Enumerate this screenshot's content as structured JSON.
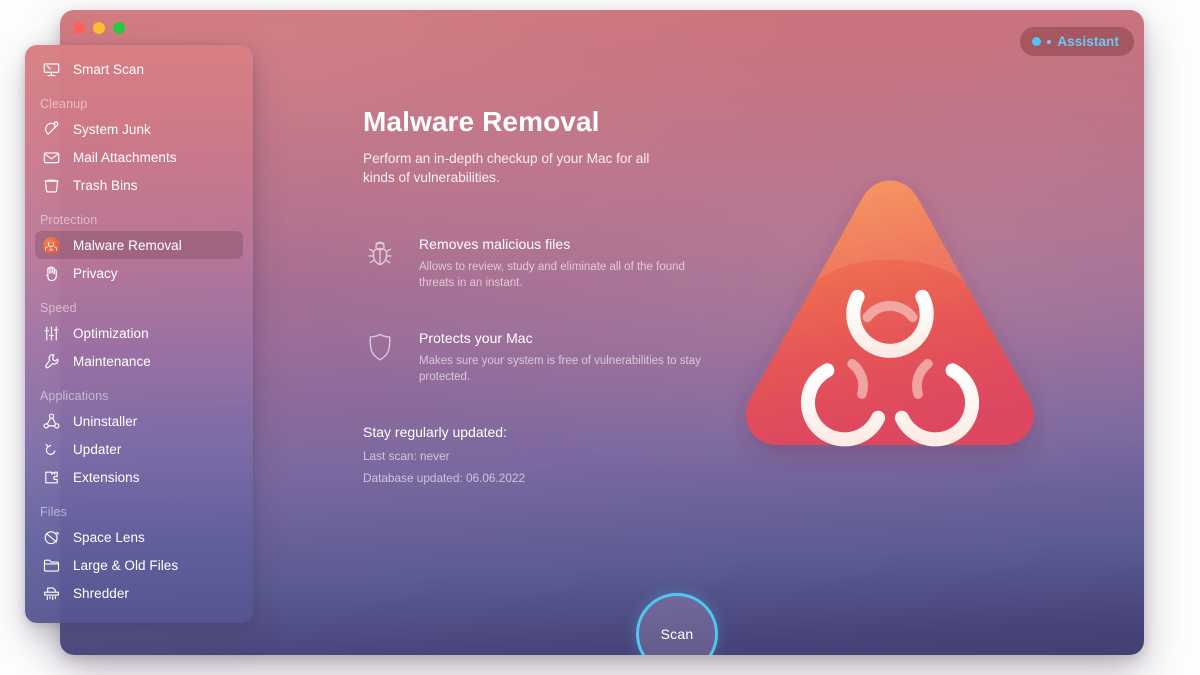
{
  "window": {
    "traffic_lights": [
      {
        "name": "close",
        "color": "#ff5f57"
      },
      {
        "name": "minimize",
        "color": "#febc2e"
      },
      {
        "name": "maximize",
        "color": "#28c840"
      }
    ],
    "assistant": {
      "label": "Assistant",
      "dot_color": "#54c3f2",
      "text_color": "#6cc8f5"
    },
    "background": {
      "top_color": "#cf757b",
      "bottom_color": "#423f73"
    }
  },
  "sidebar": {
    "groups": [
      {
        "label": "",
        "items": [
          {
            "label": "Smart Scan",
            "icon": "monitor-icon",
            "active": false
          }
        ]
      },
      {
        "label": "Cleanup",
        "items": [
          {
            "label": "System Junk",
            "icon": "broom-icon",
            "active": false
          },
          {
            "label": "Mail Attachments",
            "icon": "envelope-icon",
            "active": false
          },
          {
            "label": "Trash Bins",
            "icon": "trash-bin-icon",
            "active": false
          }
        ]
      },
      {
        "label": "Protection",
        "items": [
          {
            "label": "Malware Removal",
            "icon": "biohazard-icon",
            "active": true
          },
          {
            "label": "Privacy",
            "icon": "hand-icon",
            "active": false
          }
        ]
      },
      {
        "label": "Speed",
        "items": [
          {
            "label": "Optimization",
            "icon": "sliders-icon",
            "active": false
          },
          {
            "label": "Maintenance",
            "icon": "wrench-icon",
            "active": false
          }
        ]
      },
      {
        "label": "Applications",
        "items": [
          {
            "label": "Uninstaller",
            "icon": "molecule-icon",
            "active": false
          },
          {
            "label": "Updater",
            "icon": "refresh-arrow-icon",
            "active": false
          },
          {
            "label": "Extensions",
            "icon": "puzzle-piece-icon",
            "active": false
          }
        ]
      },
      {
        "label": "Files",
        "items": [
          {
            "label": "Space Lens",
            "icon": "planet-icon",
            "active": false
          },
          {
            "label": "Large & Old Files",
            "icon": "folder-icon",
            "active": false
          },
          {
            "label": "Shredder",
            "icon": "shredder-icon",
            "active": false
          }
        ]
      }
    ]
  },
  "main": {
    "title": "Malware Removal",
    "subtitle": "Perform an in-depth checkup of your Mac for all kinds of vulnerabilities.",
    "features": [
      {
        "icon": "bug-icon",
        "title": "Removes malicious files",
        "description": "Allows to review, study and eliminate all of the found threats in an instant."
      },
      {
        "icon": "shield-icon",
        "title": "Protects your Mac",
        "description": "Makes sure your system is free of vulnerabilities to stay protected."
      }
    ],
    "status": {
      "heading": "Stay regularly updated:",
      "last_scan": "Last scan: never",
      "database_updated": "Database updated: 06.06.2022"
    },
    "illustration": {
      "icon": "biohazard-triangle-icon",
      "gradient_top": "#f5874d",
      "gradient_bottom": "#e24e5c"
    },
    "scan_button": {
      "label": "Scan",
      "ring_color": "#4fc7f0"
    }
  }
}
